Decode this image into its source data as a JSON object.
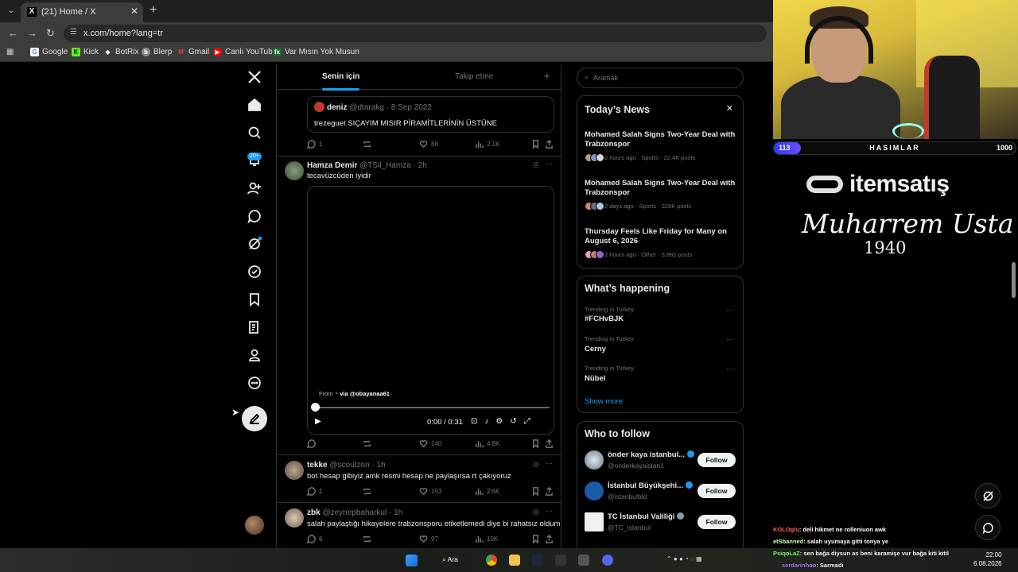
{
  "browser": {
    "tab_title": "(21) Home / X",
    "url": "x.com/home?lang=tr",
    "bookmarks": [
      "Google",
      "Kick",
      "BotRix",
      "Blerp",
      "Gmail",
      "Canlı YouTube",
      "Var Mısın Yok Musun"
    ]
  },
  "nav": {
    "notification_badge": "20+"
  },
  "timeline": {
    "tabs": [
      "Senin için",
      "Takip etme"
    ],
    "posts": [
      {
        "quoted_name": "deniz",
        "quoted_meta": "@dtarakg · 8 Sep 2022",
        "quoted_text": "trezeguet SIÇAYIM MISIR PİRAMİTLERİNİN ÜSTÜNE",
        "replies": "1",
        "likes": "88",
        "views": "2.1K"
      },
      {
        "name": "Hamza Demir",
        "meta": "@TSil_Hamza · 2h",
        "text": "tecavüzcüden iyidir",
        "video_from": "From",
        "video_via": "via @obayanaa61",
        "video_time": "0:00 / 0:31",
        "replies": "",
        "likes": "140",
        "views": "4.8K"
      },
      {
        "name": "tekke",
        "meta": "@scoutzon · 1h",
        "text": "bot hesap gibiyiz amk resmi hesap ne paylaşırsa rt çakıyoruz",
        "replies": "1",
        "likes": "153",
        "views": "2.6K"
      },
      {
        "name": "zbk",
        "meta": "@zeynepbaharkul · 1h",
        "text": "salah paylaştığı hikayelere trabzonsporu etiketlemedi diye bi rahatsız oldum",
        "replies": "6",
        "likes": "97",
        "views": "10K"
      }
    ]
  },
  "right": {
    "search_placeholder": "Aramak",
    "news_title": "Today’s News",
    "news": [
      {
        "title": "Mohamed Salah Signs Two-Year Deal with Trabzonspor",
        "meta": "2 hours ago · Sports · 22.4K posts"
      },
      {
        "title": "Mohamed Salah Signs Two-Year Deal with Trabzonspor",
        "meta": "2 days ago · Sports · 328K posts"
      },
      {
        "title": "Thursday Feels Like Friday for Many on August 6, 2026",
        "meta": "2 hours ago · Other · 3,882 posts"
      }
    ],
    "happening_title": "What’s happening",
    "trends": [
      {
        "label": "Trending in Turkey",
        "name": "#FCHvBJK"
      },
      {
        "label": "Trending in Turkey",
        "name": "Cerny"
      },
      {
        "label": "Trending in Turkey",
        "name": "Nübel"
      }
    ],
    "show_more": "Show more",
    "wtf_title": "Who to follow",
    "follow_label": "Follow",
    "wtf": [
      {
        "name": "önder kaya istanbul...",
        "handle": "@onderkayaistan1"
      },
      {
        "name": "İstanbul Büyükşehi...",
        "handle": "@istanbulbld"
      },
      {
        "name": "TC İstanbul Valiliği",
        "handle": "@TC_istanbul"
      }
    ]
  },
  "overlay": {
    "bar_left": "113",
    "bar_label": "HASIMLAR",
    "bar_right": "1000",
    "bar_progress": 0.113,
    "sponsor": "itemsatış",
    "signature": "Muharrem Usta",
    "year": "1940",
    "chat": [
      {
        "user": "KOLOglu",
        "msg": ": deli hikmet ne rolleniuon awk",
        "color": "#ff5c5c"
      },
      {
        "user": "etSbanned",
        "msg": ": salah uyumaya gitti tonya ye",
        "color": "#c9ffb0"
      },
      {
        "user": "PsiqoLaZ",
        "msg": ": sen bağa diysun as beni karamişe vur bağa kiti kitil",
        "color": "#7cff6a"
      },
      {
        "user": "serdarinhoo",
        "msg": ": Sarmadı",
        "color": "#b07bff"
      }
    ]
  },
  "taskbar": {
    "search": "Ara",
    "time": "22:00",
    "date": "6.08.2026"
  }
}
